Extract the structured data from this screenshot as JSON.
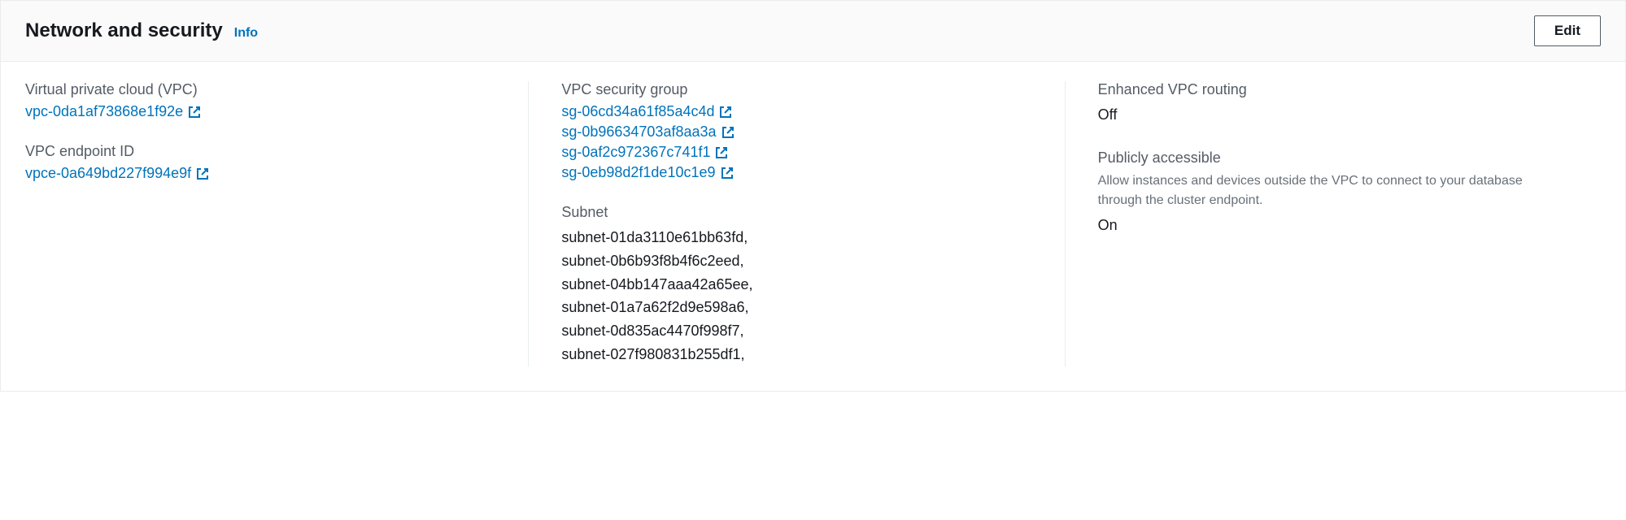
{
  "header": {
    "title": "Network and security",
    "infoLabel": "Info",
    "editLabel": "Edit"
  },
  "col1": {
    "vpc": {
      "label": "Virtual private cloud (VPC)",
      "value": "vpc-0da1af73868e1f92e"
    },
    "vpcEndpoint": {
      "label": "VPC endpoint ID",
      "value": "vpce-0a649bd227f994e9f"
    }
  },
  "col2": {
    "securityGroup": {
      "label": "VPC security group",
      "items": [
        "sg-06cd34a61f85a4c4d",
        "sg-0b96634703af8aa3a",
        "sg-0af2c972367c741f1",
        "sg-0eb98d2f1de10c1e9"
      ]
    },
    "subnet": {
      "label": "Subnet",
      "items": [
        "subnet-01da3110e61bb63fd",
        "subnet-0b6b93f8b4f6c2eed",
        "subnet-04bb147aaa42a65ee",
        "subnet-01a7a62f2d9e598a6",
        "subnet-0d835ac4470f998f7",
        "subnet-027f980831b255df1"
      ]
    }
  },
  "col3": {
    "enhancedRouting": {
      "label": "Enhanced VPC routing",
      "value": "Off"
    },
    "publiclyAccessible": {
      "label": "Publicly accessible",
      "description": "Allow instances and devices outside the VPC to connect to your database through the cluster endpoint.",
      "value": "On"
    }
  }
}
